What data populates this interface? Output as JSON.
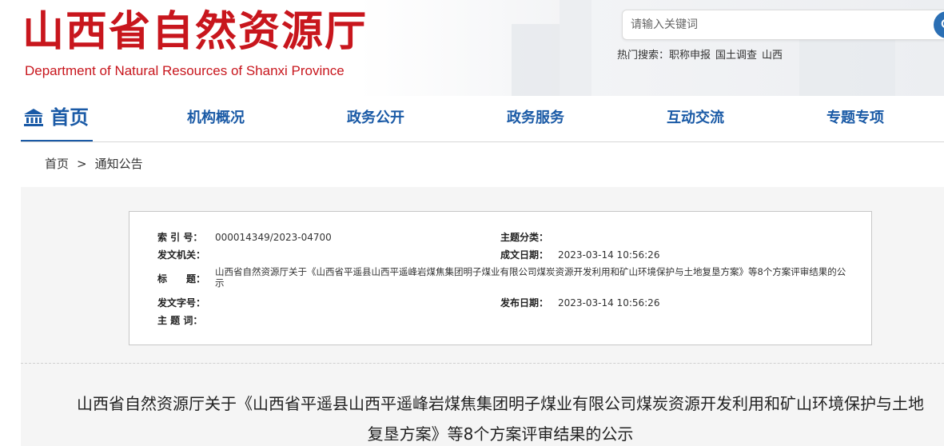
{
  "header": {
    "logo_cn": "山西省自然资源厅",
    "logo_en": "Department of Natural Resources of Shanxi Province",
    "search_placeholder": "请输入关键词",
    "hot_label": "热门搜索：",
    "hot_terms": [
      "职称申报",
      "国土调查",
      "山西"
    ]
  },
  "nav": {
    "home": "首页",
    "items": [
      "机构概况",
      "政务公开",
      "政务服务",
      "互动交流",
      "专题专项"
    ]
  },
  "breadcrumb": {
    "home": "首页",
    "separator": ">",
    "current": "通知公告"
  },
  "meta": {
    "index_label": "索 引 号：",
    "index_value": "000014349/2023-04700",
    "topic_label": "主题分类：",
    "topic_value": "",
    "issuer_label": "发文机关：",
    "issuer_value": "",
    "created_label": "成文日期：",
    "created_value": "2023-03-14 10:56:26",
    "title_label": "标　　题：",
    "title_value": "山西省自然资源厅关于《山西省平遥县山西平遥峰岩煤焦集团明子煤业有限公司煤炭资源开发利用和矿山环境保护与土地复垦方案》等8个方案评审结果的公示",
    "docno_label": "发文字号：",
    "docno_value": "",
    "published_label": "发布日期：",
    "published_value": "2023-03-14 10:56:26",
    "keywords_label": "主 题 词：",
    "keywords_value": ""
  },
  "article": {
    "title": "山西省自然资源厅关于《山西省平遥县山西平遥峰岩煤焦集团明子煤业有限公司煤炭资源开发利用和矿山环境保护与土地复垦方案》等8个方案评审结果的公示"
  },
  "colors": {
    "brand_red": "#c8161d",
    "nav_blue": "#1a5aa6",
    "search_button": "#2b6fb4"
  },
  "icons": {
    "home": "institution-building-icon",
    "search": "search-icon"
  }
}
